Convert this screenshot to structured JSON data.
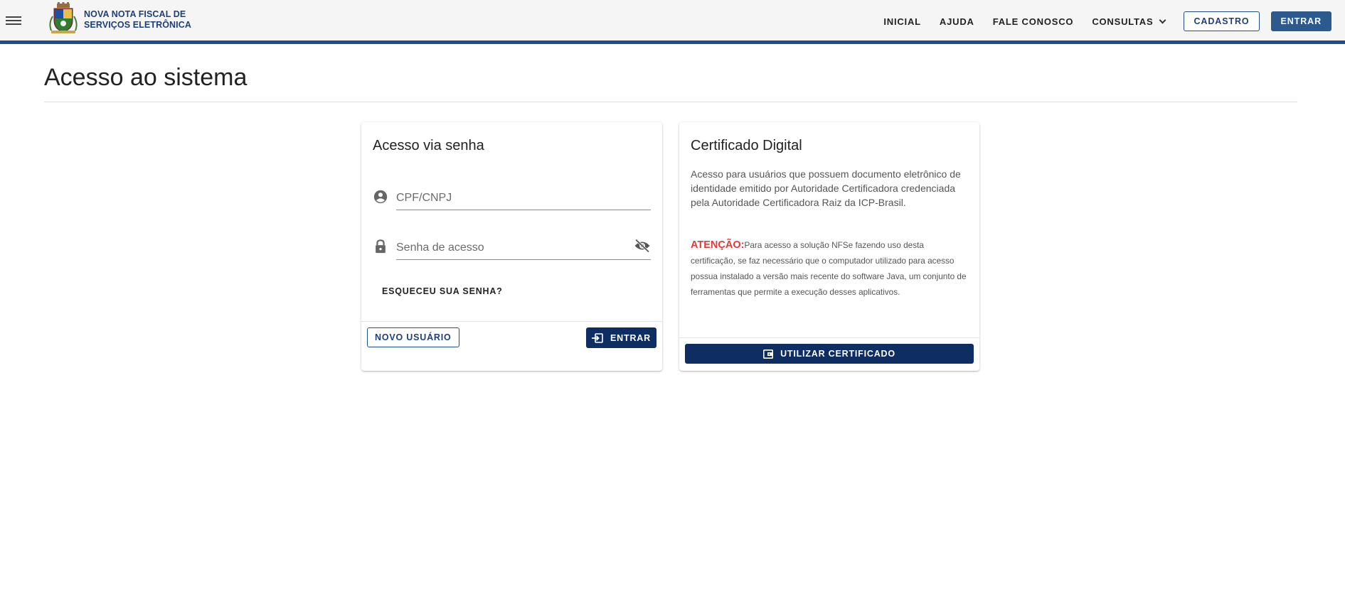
{
  "header": {
    "brand_line1": "NOVA NOTA FISCAL DE",
    "brand_line2": "SERVIÇOS ELETRÔNICA",
    "nav": {
      "inicial": "INICIAL",
      "ajuda": "AJUDA",
      "fale_conosco": "FALE CONOSCO",
      "consultas": "CONSULTAS",
      "cadastro": "CADASTRO",
      "entrar": "ENTRAR"
    },
    "accent_color": "#1f4e8c"
  },
  "page": {
    "title": "Acesso ao sistema"
  },
  "password_card": {
    "title": "Acesso via senha",
    "cpf_placeholder": "CPF/CNPJ",
    "cpf_value": "",
    "password_placeholder": "Senha de acesso",
    "password_value": "",
    "forgot_label": "ESQUECEU SUA SENHA?",
    "new_user_label": "NOVO USUÁRIO",
    "enter_label": "ENTRAR",
    "icons": {
      "cpf": "account-circle-icon",
      "password": "lock-icon",
      "visibility": "eye-off-icon",
      "enter": "login-icon"
    }
  },
  "cert_card": {
    "title": "Certificado Digital",
    "description": "Acesso para usuários que possuem documento eletrônico de identidade emitido por Autoridade Certificadora credenciada pela Autoridade Certificadora Raiz da ICP-Brasil.",
    "warning_label": "ATENÇÃO:",
    "warning_text": "Para acesso a solução NFSe fazendo uso desta certificação, se faz necessário que o computador utilizado para acesso possua instalado a versão mais recente do software Java, um conjunto de ferramentas que permite a execução desses aplicativos.",
    "button_label": "UTILIZAR CERTIFICADO",
    "warning_color": "#e53935",
    "button_color": "#0e2e63"
  }
}
